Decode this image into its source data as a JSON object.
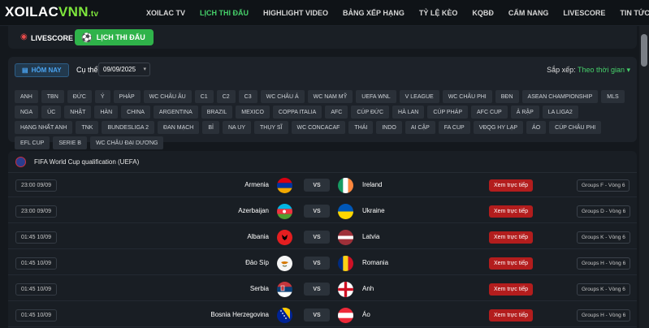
{
  "header": {
    "logo_main": "XOILAC",
    "logo_accent": "VNN",
    "logo_suffix": ".tv",
    "nav": [
      {
        "label": "XOILAC TV",
        "active": false
      },
      {
        "label": "LỊCH THI ĐẤU",
        "active": true
      },
      {
        "label": "HIGHLIGHT VIDEO",
        "active": false
      },
      {
        "label": "BẢNG XẾP HẠNG",
        "active": false
      },
      {
        "label": "TỶ LỆ KÈO",
        "active": false
      },
      {
        "label": "KQBĐ",
        "active": false
      },
      {
        "label": "CẨM NANG",
        "active": false
      },
      {
        "label": "LIVESCORE",
        "active": false
      },
      {
        "label": "TIN TỨC MỚI",
        "active": false
      }
    ]
  },
  "subbar": {
    "live_label": "LIVESCORE",
    "schedule_label": "LỊCH THI ĐẤU"
  },
  "filters": {
    "today_label": "HÔM NAY",
    "date_label": "Cụ thể",
    "date_value": "09/09/2025",
    "sort_label": "Sắp xếp:",
    "sort_value": "Theo thời gian",
    "chips": [
      "ANH",
      "TBN",
      "ĐỨC",
      "Ý",
      "PHÁP",
      "WC CHÂU ÂU",
      "C1",
      "C2",
      "C3",
      "WC CHÂU Á",
      "WC NAM MỸ",
      "UEFA WNL",
      "V LEAGUE",
      "WC CHÂU PHI",
      "BĐN",
      "ASEAN CHAMPIONSHIP",
      "MLS",
      "NGA",
      "ÚC",
      "NHẬT",
      "HÀN",
      "CHINA",
      "ARGENTINA",
      "BRAZIL",
      "MEXICO",
      "COPPA ITALIA",
      "AFC",
      "CÚP ĐỨC",
      "HÀ LAN",
      "CÚP PHÁP",
      "AFC CUP",
      "Ả RẬP",
      "LA LIGA2",
      "HẠNG NHẤT ANH",
      "TNK",
      "BUNDESLIGA 2",
      "ĐAN MẠCH",
      "BỈ",
      "NA UY",
      "THỤY SĨ",
      "WC CONCACAF",
      "THÁI",
      "INDO",
      "AI CẬP",
      "FA CUP",
      "VĐQG HY LẠP",
      "ÁO",
      "CÚP CHÂU PHI",
      "EFL CUP",
      "SERIE B",
      "WC CHÂU ĐẠI DƯƠNG"
    ]
  },
  "league": {
    "title": "FIFA World Cup qualification (UEFA)",
    "matches": [
      {
        "time": "23:00 09/09",
        "home": "Armenia",
        "away": "Ireland",
        "vs": "VS",
        "watch": "Xem trực tiếp",
        "group": "Groups F - Vòng 6"
      },
      {
        "time": "23:00 09/09",
        "home": "Azerbaijan",
        "away": "Ukraine",
        "vs": "VS",
        "watch": "Xem trực tiếp",
        "group": "Groups D - Vòng 6"
      },
      {
        "time": "01:45 10/09",
        "home": "Albania",
        "away": "Latvia",
        "vs": "VS",
        "watch": "Xem trực tiếp",
        "group": "Groups K - Vòng 6"
      },
      {
        "time": "01:45 10/09",
        "home": "Đảo Síp",
        "away": "Romania",
        "vs": "VS",
        "watch": "Xem trực tiếp",
        "group": "Groups H - Vòng 6"
      },
      {
        "time": "01:45 10/09",
        "home": "Serbia",
        "away": "Anh",
        "vs": "VS",
        "watch": "Xem trực tiếp",
        "group": "Groups K - Vòng 6"
      },
      {
        "time": "01:45 10/09",
        "home": "Bosnia Herzegovina",
        "away": "Áo",
        "vs": "VS",
        "watch": "Xem trực tiếp",
        "group": "Groups H - Vòng 6"
      }
    ]
  },
  "colors": {
    "accent": "#46d06a",
    "live": "#b31d1d",
    "background": "#14181d"
  }
}
